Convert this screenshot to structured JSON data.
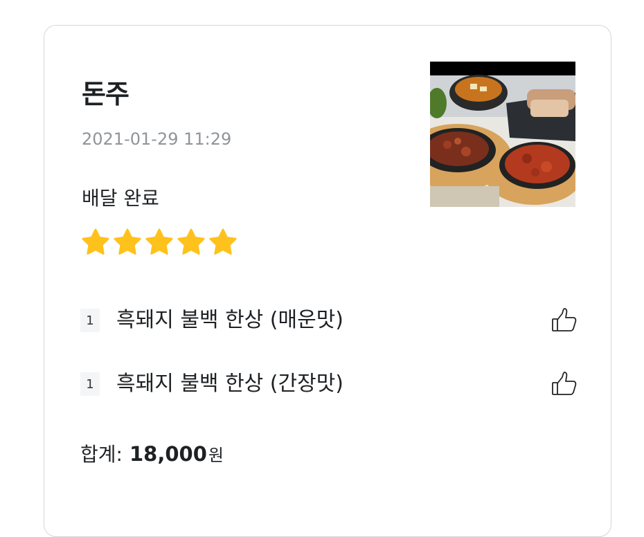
{
  "order": {
    "store_name": "돈주",
    "date": "2021-01-29 11:29",
    "status": "배달 완료",
    "rating": 5,
    "rating_max": 5,
    "star_color": "#ffc21c",
    "thumbnail_icon": "food-photo",
    "items": [
      {
        "qty": "1",
        "name": "흑돼지 불백 한상 (매운맛)",
        "action_icon": "thumbs-up-icon"
      },
      {
        "qty": "1",
        "name": "흑돼지 불백 한상 (간장맛)",
        "action_icon": "thumbs-up-icon"
      }
    ],
    "total_label": "합계:",
    "total_value": "18,000",
    "total_unit": "원"
  }
}
